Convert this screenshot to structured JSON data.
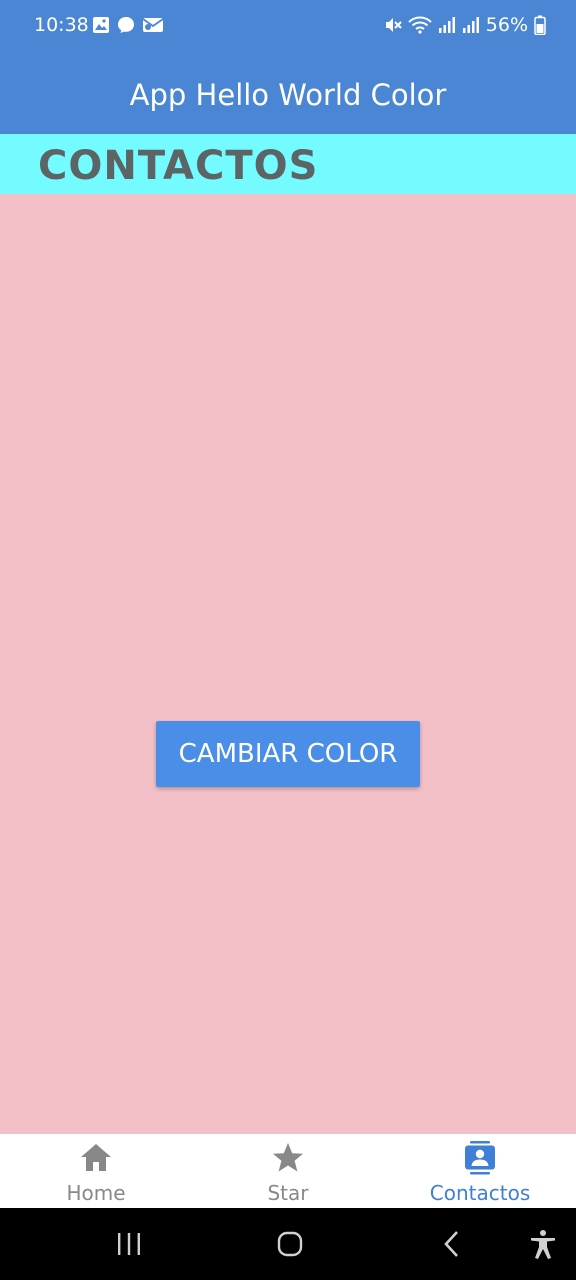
{
  "status_bar": {
    "time": "10:38",
    "battery_percent": "56%",
    "icons_left": [
      "image-icon",
      "chat-bubble-icon",
      "mail-icon"
    ],
    "icons_right": [
      "mute-icon",
      "wifi-icon",
      "signal-icon",
      "signal-icon",
      "battery-icon"
    ]
  },
  "app_bar": {
    "title": "App Hello World Color"
  },
  "section": {
    "title": "CONTACTOS"
  },
  "main": {
    "button_label": "CAMBIAR COLOR"
  },
  "bottom_nav": {
    "items": [
      {
        "label": "Home",
        "icon": "home-icon",
        "active": false
      },
      {
        "label": "Star",
        "icon": "star-icon",
        "active": false
      },
      {
        "label": "Contactos",
        "icon": "contacts-icon",
        "active": true
      }
    ]
  },
  "system_nav": {
    "buttons": [
      "recents-icon",
      "home-circle-icon",
      "back-icon",
      "accessibility-icon"
    ]
  },
  "colors": {
    "app_bar": "#4a86d4",
    "section_header": "#74fbff",
    "content_background": "#f4c0c8",
    "button": "#4a8ee8",
    "active_nav": "#3f7fd6",
    "inactive_nav": "#888888"
  }
}
